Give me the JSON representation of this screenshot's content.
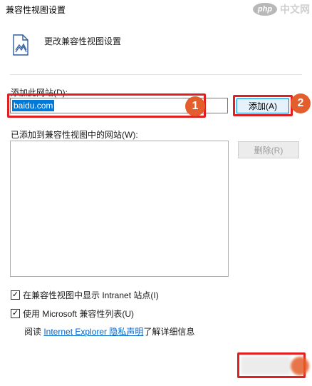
{
  "window": {
    "title": "兼容性视图设置"
  },
  "watermark": {
    "logo": "php",
    "text": "中文网"
  },
  "header": {
    "text": "更改兼容性视图设置",
    "icon": "document-icon"
  },
  "add_site": {
    "label": "添加此网站(D):",
    "value": "baidu.com",
    "button_label": "添加(A)"
  },
  "added_list": {
    "label": "已添加到兼容性视图中的网站(W):",
    "items": [],
    "remove_label": "删除(R)"
  },
  "options": {
    "intranet": {
      "label": "在兼容性视图中显示 Intranet 站点(I)",
      "checked": true
    },
    "ms_list": {
      "label": "使用 Microsoft 兼容性列表(U)",
      "checked": true
    }
  },
  "footer": {
    "prefix": "阅读 ",
    "link": "Internet Explorer 隐私声明",
    "suffix": "了解详细信息"
  },
  "annotations": {
    "step1": "1",
    "step2": "2"
  },
  "colors": {
    "accent": "#0078d7",
    "highlight": "#e02020",
    "badge": "#e35e2c"
  }
}
